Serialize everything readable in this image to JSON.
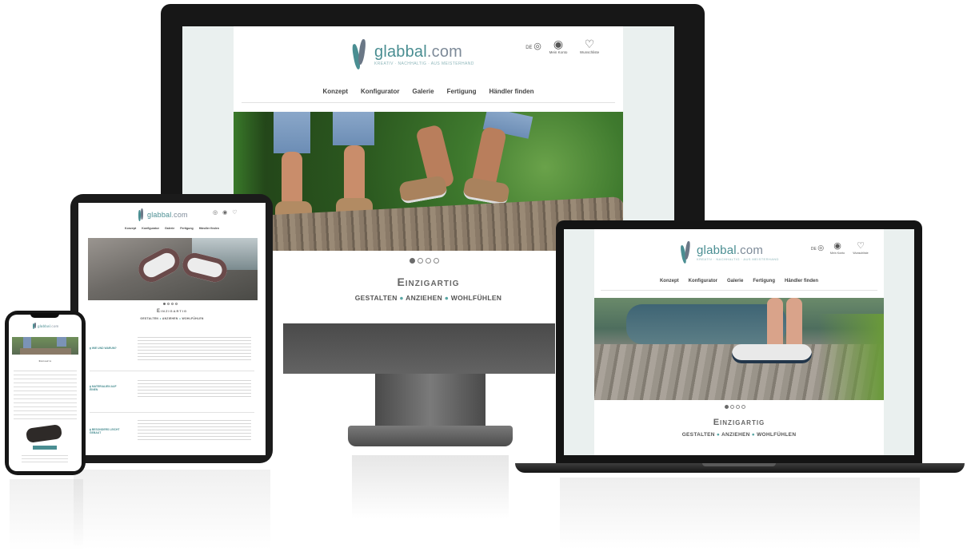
{
  "brand": {
    "name": "glabbal",
    "tld": ".com",
    "tagline": "KREATIV · NACHHALTIG · AUS MEISTERHAND"
  },
  "header": {
    "lang": "DE",
    "account": "Mein Konto",
    "wishlist": "Wunschliste"
  },
  "nav": [
    "Konzept",
    "Konfigurator",
    "Galerie",
    "Fertigung",
    "Händler finden"
  ],
  "hero_dots": 4,
  "slogan": {
    "title": "Einzigartig",
    "sub1": "GESTALTEN",
    "sub2": "ANZIEHEN",
    "sub3": "WOHLFÜHLEN"
  },
  "tablet_sections": [
    {
      "label": "WIE UND WARUM?"
    },
    {
      "label": "MATERIALIEN AUF EINEN"
    },
    {
      "label": "BESONDERS LEICHT GEBAUT"
    }
  ],
  "colors": {
    "accent": "#4a8e92",
    "device_frame": "#1b1b1b",
    "stand": "#5b5b5b"
  }
}
